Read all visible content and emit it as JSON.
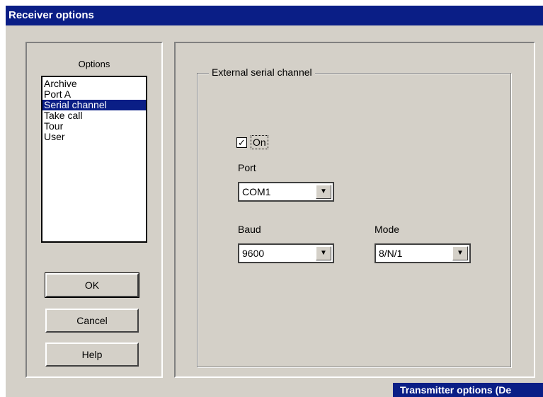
{
  "window": {
    "title": "Receiver options"
  },
  "options": {
    "label": "Options",
    "items": [
      {
        "label": "Archive"
      },
      {
        "label": "Port A"
      },
      {
        "label": "Serial channel"
      },
      {
        "label": "Take call"
      },
      {
        "label": "Tour"
      },
      {
        "label": "User"
      }
    ],
    "selected": "Serial channel"
  },
  "buttons": {
    "ok": "OK",
    "cancel": "Cancel",
    "help": "Help"
  },
  "serial": {
    "group_title": "External serial channel",
    "on_checked": true,
    "on_label": "On",
    "port_label": "Port",
    "port_value": "COM1",
    "baud_label": "Baud",
    "baud_value": "9600",
    "mode_label": "Mode",
    "mode_value": "8/N/1"
  },
  "taskbar": {
    "label": "Transmitter options (De"
  }
}
